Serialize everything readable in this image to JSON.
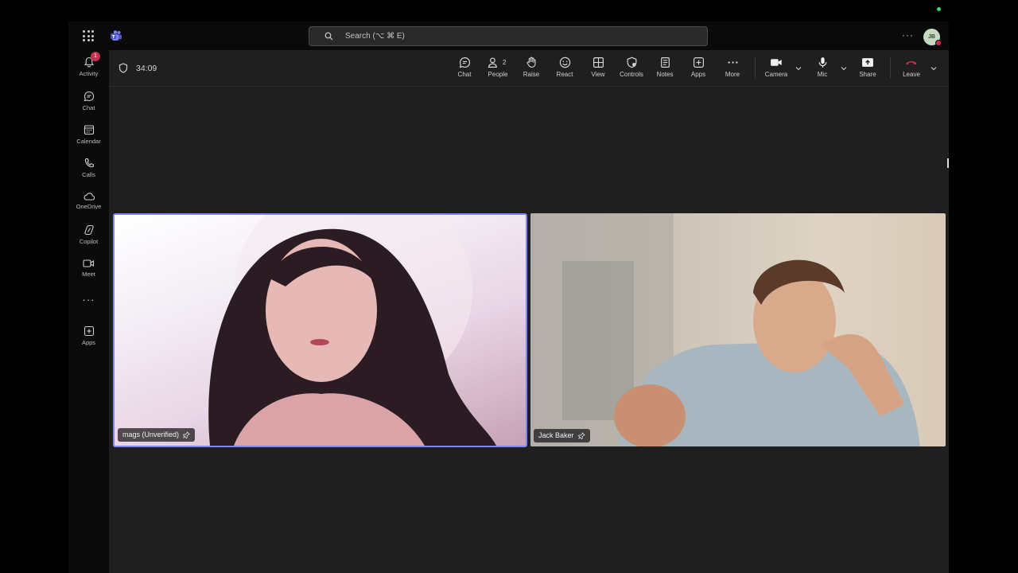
{
  "search": {
    "placeholder": "Search (⌥ ⌘ E)"
  },
  "user": {
    "initials": "JB"
  },
  "rail": {
    "activity_badge": "1",
    "items": [
      {
        "label": "Activity",
        "icon": "bell-icon"
      },
      {
        "label": "Chat",
        "icon": "chat-icon"
      },
      {
        "label": "Calendar",
        "icon": "calendar-icon"
      },
      {
        "label": "Calls",
        "icon": "phone-icon"
      },
      {
        "label": "OneDrive",
        "icon": "cloud-icon"
      },
      {
        "label": "Copilot",
        "icon": "copilot-icon"
      },
      {
        "label": "Meet",
        "icon": "video-icon"
      },
      {
        "label": "Apps",
        "icon": "add-app-icon"
      }
    ]
  },
  "meeting": {
    "timer": "34:09",
    "people_count": "2",
    "toolbar": [
      {
        "label": "Chat",
        "icon": "chat-icon"
      },
      {
        "label": "People",
        "icon": "people-icon"
      },
      {
        "label": "Raise",
        "icon": "hand-icon"
      },
      {
        "label": "React",
        "icon": "smile-icon"
      },
      {
        "label": "View",
        "icon": "grid-icon"
      },
      {
        "label": "Controls",
        "icon": "shield-icon"
      },
      {
        "label": "Notes",
        "icon": "notes-icon"
      },
      {
        "label": "Apps",
        "icon": "add-app-icon"
      },
      {
        "label": "More",
        "icon": "more-icon"
      },
      {
        "label": "Camera",
        "icon": "camera-icon"
      },
      {
        "label": "Mic",
        "icon": "mic-icon"
      },
      {
        "label": "Share",
        "icon": "share-icon"
      },
      {
        "label": "Leave",
        "icon": "hangup-icon"
      }
    ],
    "participants": [
      {
        "name": "mags (Unverified)"
      },
      {
        "name": "Jack Baker"
      }
    ]
  },
  "colors": {
    "accent": "#7f85f5",
    "leave": "#c4314b",
    "background": "#1f1f1f"
  }
}
